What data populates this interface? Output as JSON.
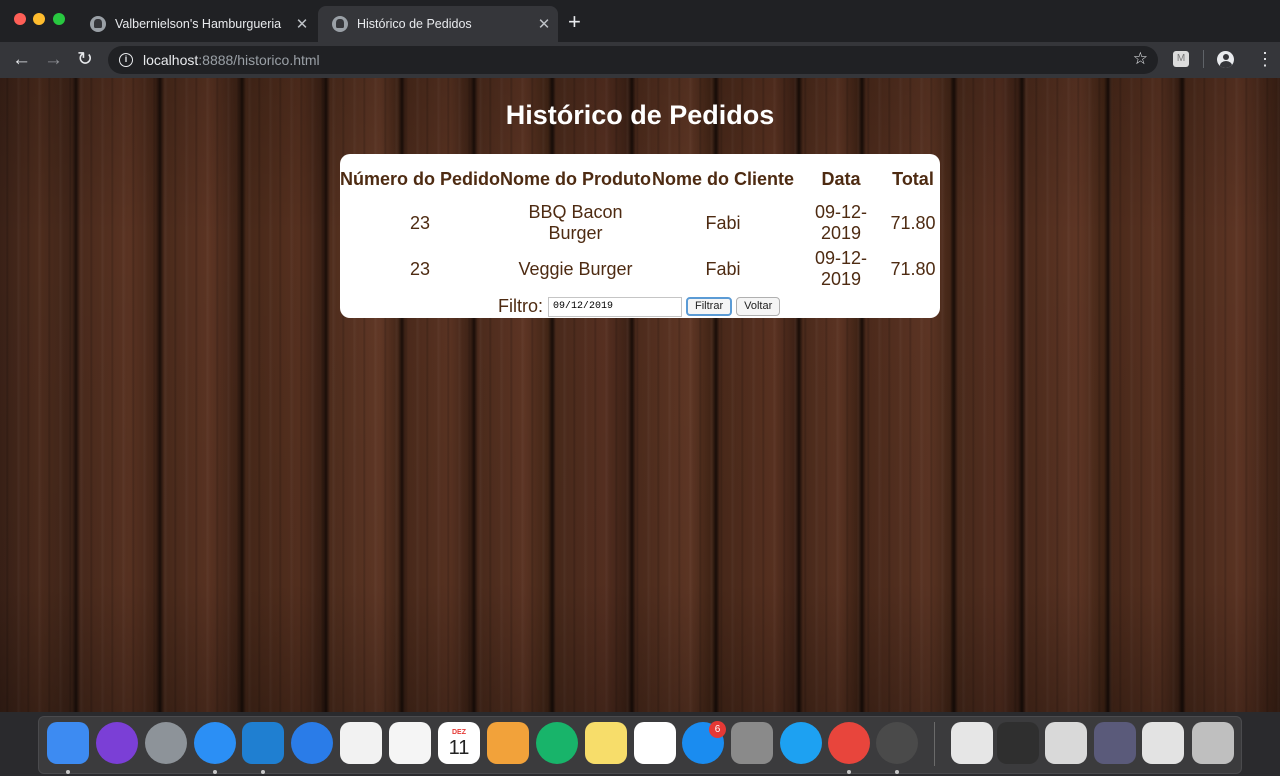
{
  "browser": {
    "tabs": [
      {
        "title": "Valbernielson's Hamburgueria",
        "active": false
      },
      {
        "title": "Histórico de Pedidos",
        "active": true
      }
    ],
    "close_glyph": "✕",
    "new_tab_glyph": "+",
    "url_host": "localhost",
    "url_rest": ":8888/historico.html"
  },
  "page": {
    "title": "Histórico de Pedidos",
    "table": {
      "headers": [
        "Número do Pedido",
        "Nome do Produto",
        "Nome do Cliente",
        "Data",
        "Total"
      ],
      "rows": [
        [
          "23",
          "BBQ Bacon Burger",
          "Fabi",
          "09-12-2019",
          "71.80"
        ],
        [
          "23",
          "Veggie Burger",
          "Fabi",
          "09-12-2019",
          "71.80"
        ]
      ]
    },
    "filter": {
      "label": "Filtro:",
      "date_value": "09/12/2019",
      "filter_button": "Filtrar",
      "back_button": "Voltar"
    }
  },
  "dock": {
    "badge_count": "6",
    "calendar_month": "DEZ",
    "calendar_day": "11",
    "items": [
      {
        "name": "finder-icon",
        "color": "#3d8bf2"
      },
      {
        "name": "siri-icon",
        "color": "#7b3fd6"
      },
      {
        "name": "launchpad-icon",
        "color": "#8d9399"
      },
      {
        "name": "safari-icon",
        "color": "#2b8ff5"
      },
      {
        "name": "vscode-icon",
        "color": "#1f7fd1"
      },
      {
        "name": "spark-icon",
        "color": "#2a7ce8"
      },
      {
        "name": "music-icon",
        "color": "#f2f2f2"
      },
      {
        "name": "photos-icon",
        "color": "#f5f5f5"
      },
      {
        "name": "calendar-icon",
        "color": "#ffffff"
      },
      {
        "name": "pages-icon",
        "color": "#f2a23a"
      },
      {
        "name": "direct-mail-icon",
        "color": "#18b46a"
      },
      {
        "name": "notes-icon",
        "color": "#f7dd6a"
      },
      {
        "name": "reminders-icon",
        "color": "#ffffff"
      },
      {
        "name": "app-store-icon",
        "color": "#1a8cf0"
      },
      {
        "name": "system-preferences-icon",
        "color": "#8a8a8a"
      },
      {
        "name": "twitter-icon",
        "color": "#1da1f2"
      },
      {
        "name": "chrome-icon",
        "color": "#e8453c"
      },
      {
        "name": "mamp-icon",
        "color": "#4a4a4a"
      },
      {
        "name": "document-stack-icon",
        "color": "#e6e6e6"
      },
      {
        "name": "screenshot-1-icon",
        "color": "#2f2f2f"
      },
      {
        "name": "screenshot-2-icon",
        "color": "#d9d9d9"
      },
      {
        "name": "screenshot-3-icon",
        "color": "#5a5a7a"
      },
      {
        "name": "screenshot-4-icon",
        "color": "#e3e3e3"
      },
      {
        "name": "trash-icon",
        "color": "#bfbfbf"
      }
    ]
  }
}
